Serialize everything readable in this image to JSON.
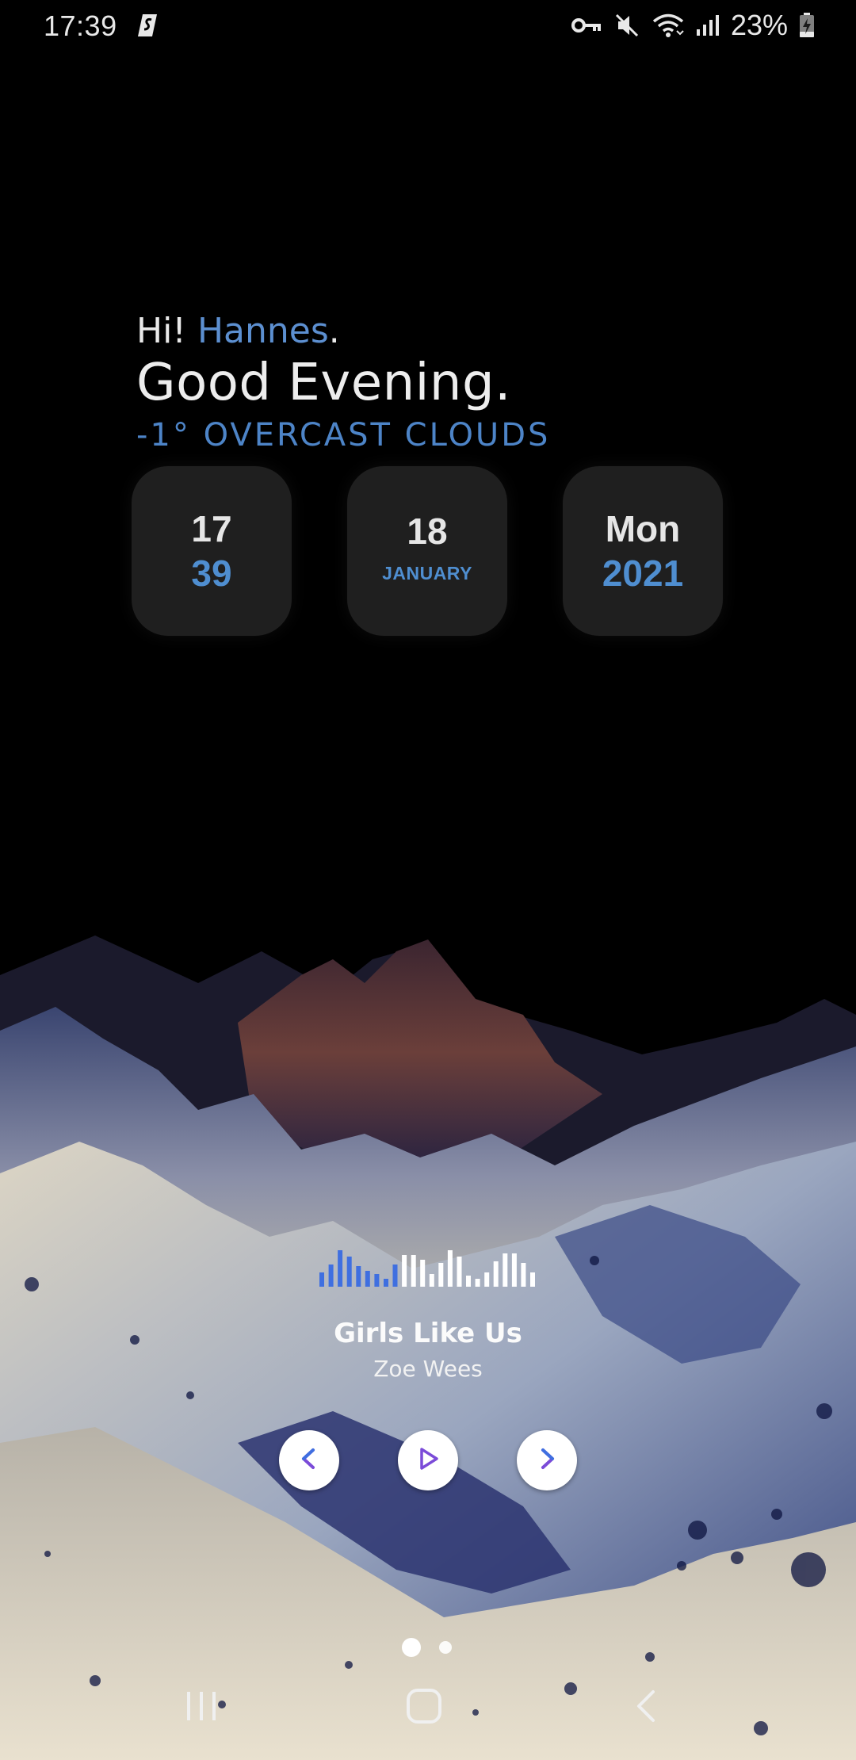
{
  "status_bar": {
    "time": "17:39",
    "battery_percent": "23%",
    "icons": [
      "app-s-icon",
      "vpn-key-icon",
      "mute-icon",
      "wifi-icon",
      "signal-icon",
      "battery-charging-icon"
    ]
  },
  "greeting": {
    "hi_prefix": "Hi! ",
    "name": "Hannes",
    "hi_suffix": ".",
    "main": "Good Evening.",
    "weather": "-1° OVERCAST CLOUDS"
  },
  "cards": [
    {
      "top": "17",
      "bottom": "39"
    },
    {
      "top": "18",
      "bottom": "JANUARY"
    },
    {
      "top": "Mon",
      "bottom": "2021"
    }
  ],
  "music": {
    "title": "Girls Like Us",
    "artist": "Zoe Wees",
    "progress_fraction": 0.35,
    "controls": [
      "previous-icon",
      "play-icon",
      "next-icon"
    ]
  },
  "pager": {
    "page_count": 2,
    "current_page": 1
  },
  "nav_bar": {
    "buttons": [
      "recents-icon",
      "home-icon",
      "back-icon"
    ]
  },
  "colors": {
    "accent": "#4f8ed0",
    "equalizer_active": "#3f6fe0",
    "card_background": "#1f1f1f",
    "control_icon": "#7b4bd8"
  }
}
